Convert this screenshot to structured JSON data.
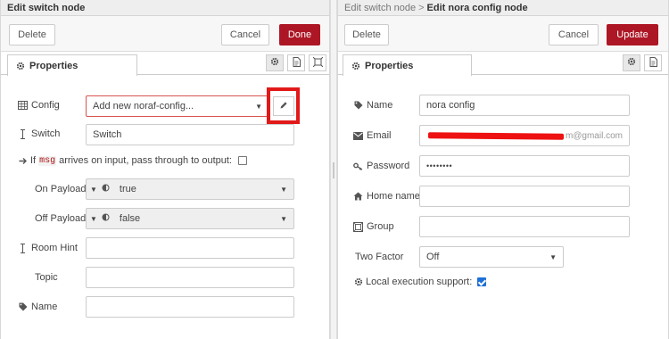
{
  "left": {
    "title": "Edit switch node",
    "delete_label": "Delete",
    "cancel_label": "Cancel",
    "done_label": "Done",
    "tab_label": "Properties",
    "config": {
      "label": "Config",
      "value": "Add new noraf-config..."
    },
    "switch": {
      "label": "Switch",
      "value": "Switch"
    },
    "passthrough": {
      "prefix": "If",
      "code": "msg",
      "suffix": "arrives on input, pass through to output:"
    },
    "on_payload": {
      "label": "On Payload",
      "value": "true"
    },
    "off_payload": {
      "label": "Off Payload",
      "value": "false"
    },
    "room_hint": {
      "label": "Room Hint",
      "value": ""
    },
    "topic": {
      "label": "Topic",
      "value": ""
    },
    "name": {
      "label": "Name",
      "value": ""
    }
  },
  "right": {
    "breadcrumb_parent": "Edit switch node",
    "breadcrumb_sep": ">",
    "title": "Edit nora config node",
    "delete_label": "Delete",
    "cancel_label": "Cancel",
    "update_label": "Update",
    "tab_label": "Properties",
    "name": {
      "label": "Name",
      "value": "nora config"
    },
    "email": {
      "label": "Email",
      "value": "m@gmail.com"
    },
    "password": {
      "label": "Password",
      "value": "••••••••"
    },
    "home_name": {
      "label": "Home name",
      "value": ""
    },
    "group": {
      "label": "Group",
      "value": ""
    },
    "two_factor": {
      "label": "Two Factor",
      "value": "Off"
    },
    "local_exec": {
      "label": "Local execution support:",
      "checked": true
    }
  },
  "colors": {
    "accent": "#ad1625",
    "highlight": "#e11919",
    "checkbox": "#1f6fd6"
  },
  "icons": [
    "gear-icon",
    "document-icon",
    "frame-icon",
    "table-icon",
    "text-cursor-icon",
    "arrow-right-icon",
    "tag-icon",
    "envelope-icon",
    "key-icon",
    "home-icon",
    "group-icon",
    "pencil-icon"
  ]
}
